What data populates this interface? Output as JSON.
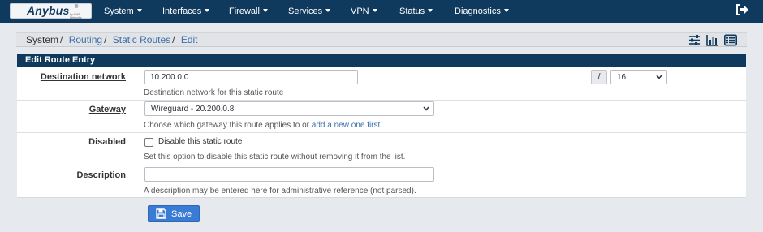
{
  "brand": {
    "logo_text": "Anybus",
    "registered_mark": "®",
    "logo_subtext": "by HMS Networks"
  },
  "navbar": {
    "items": [
      {
        "label": "System"
      },
      {
        "label": "Interfaces"
      },
      {
        "label": "Firewall"
      },
      {
        "label": "Services"
      },
      {
        "label": "VPN"
      },
      {
        "label": "Status"
      },
      {
        "label": "Diagnostics"
      }
    ],
    "logout_icon": "logout-icon"
  },
  "breadcrumb": {
    "items": [
      "System",
      "Routing",
      "Static Routes",
      "Edit"
    ],
    "separator": "/",
    "tools": [
      "sliders-icon",
      "bar-chart-icon",
      "list-icon"
    ]
  },
  "panel": {
    "title": "Edit Route Entry"
  },
  "form": {
    "destination": {
      "label": "Destination network",
      "value": "10.200.0.0",
      "slash": "/",
      "mask": "16",
      "help": "Destination network for this static route"
    },
    "gateway": {
      "label": "Gateway",
      "value": "Wireguard - 20.200.0.8",
      "help_prefix": "Choose which gateway this route applies to or ",
      "help_link": "add a new one first"
    },
    "disabled": {
      "label": "Disabled",
      "checkbox_label": "Disable this static route",
      "checked": false,
      "help": "Set this option to disable this static route without removing it from the list."
    },
    "description": {
      "label": "Description",
      "value": "",
      "help": "A description may be entered here for administrative reference (not parsed)."
    }
  },
  "save_button": {
    "label": "Save",
    "icon": "save-icon",
    "color": "#3a7bd5"
  },
  "colors": {
    "navbar": "#0f3a5e",
    "link": "#3a6fa8",
    "background": "#e6e9ee"
  }
}
